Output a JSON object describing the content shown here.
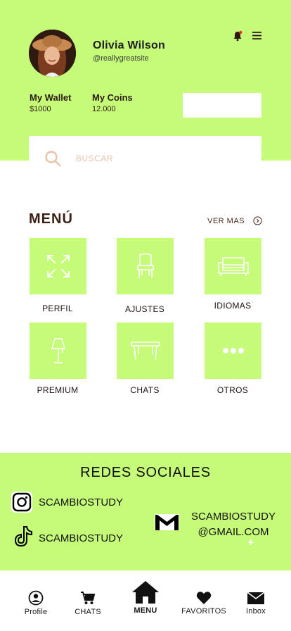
{
  "profile": {
    "name": "Olivia Wilson",
    "handle": "@reallygreatsite",
    "wallet_label": "My Wallet",
    "wallet_value": "$1000",
    "coins_label": "My Coins",
    "coins_value": "12.000"
  },
  "search": {
    "placeholder": "BUSCAR"
  },
  "menu": {
    "title": "MENÚ",
    "see_more": "VER MAS",
    "items": [
      {
        "label": "PERFIL",
        "icon": "expand-arrows-icon"
      },
      {
        "label": "AJUSTES",
        "icon": "chair-icon"
      },
      {
        "label": "IDIOMAS",
        "icon": "sofa-icon"
      },
      {
        "label": "PREMIUM",
        "icon": "lamp-icon"
      },
      {
        "label": "CHATS",
        "icon": "table-icon"
      },
      {
        "label": "OTROS",
        "icon": "more-dots-icon"
      }
    ]
  },
  "social": {
    "title": "REDES SOCIALES",
    "instagram": "SCAMBIOSTUDY",
    "tiktok": "SCAMBIOSTUDY",
    "email_line1": "SCAMBIOSTUDY",
    "email_line2": "@GMAIL.COM",
    "plus": "+"
  },
  "nav": [
    {
      "label": "Profile",
      "icon": "user-icon"
    },
    {
      "label": "CHATS",
      "icon": "cart-icon"
    },
    {
      "label": "MENU",
      "icon": "home-icon",
      "active": true
    },
    {
      "label": "FAVORITOS",
      "icon": "heart-icon"
    },
    {
      "label": "Inbox",
      "icon": "envelope-icon"
    }
  ],
  "colors": {
    "accent": "#c5fb78",
    "brown": "#3b1f14",
    "placeholder": "#e7c3a9"
  }
}
